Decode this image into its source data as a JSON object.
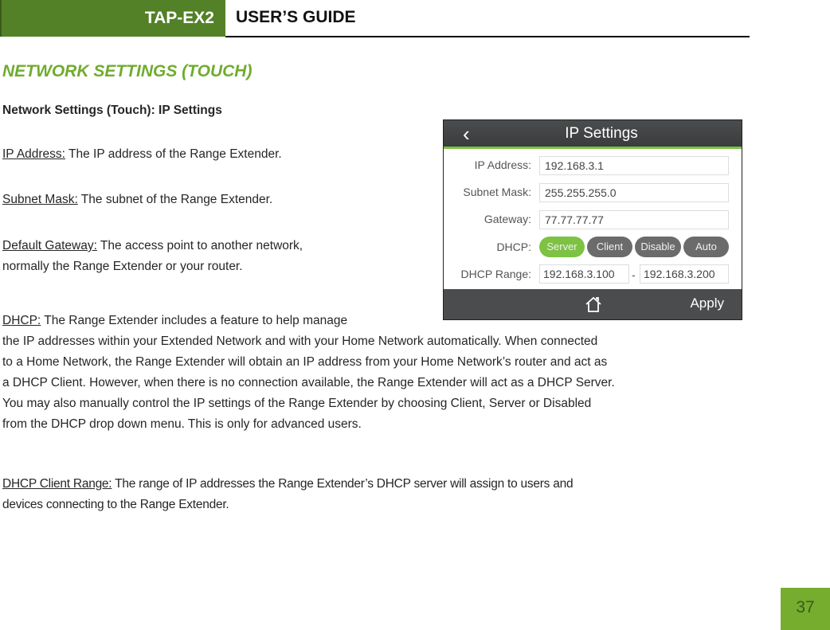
{
  "header": {
    "product": "TAP-EX2",
    "guide": "USER’S GUIDE"
  },
  "section_title": "NETWORK SETTINGS (TOUCH)",
  "subheading": "Network Settings (Touch): IP Settings",
  "paragraphs": {
    "ip_address": {
      "term": "IP Address:",
      "text": " The IP address of the Range Extender."
    },
    "subnet_mask": {
      "term": "Subnet Mask:",
      "text": " The subnet of the Range Extender."
    },
    "default_gateway": {
      "term": "Default Gateway:",
      "line1": " The access point to another network,",
      "line2": "normally the Range Extender or your router."
    },
    "dhcp": {
      "term": "DHCP:",
      "line1": " The Range Extender includes a feature to help manage",
      "line2": "the IP addresses within your Extended Network and with your Home Network automatically. When connected",
      "line3": "to a Home Network, the Range Extender will obtain an IP address from your Home Network’s router and act as",
      "line4": "a DHCP Client. However, when there is no connection available, the Range Extender will act as a DHCP Server.",
      "line5": "You may also manually control the IP settings of the Range Extender by choosing Client, Server or Disabled",
      "line6": "from the DHCP drop down menu. This is only for advanced users."
    },
    "dhcp_client_range": {
      "term": "DHCP Client Range:",
      "line1": " The range of IP addresses the Range Extender’s DHCP server will assign to users and",
      "line2": "devices connecting to the Range Extender."
    }
  },
  "screen": {
    "title": "IP Settings",
    "back_icon": "chevron-left-icon",
    "fields": {
      "ip_address": {
        "label": "IP Address:",
        "value": "192.168.3.1"
      },
      "subnet_mask": {
        "label": "Subnet Mask:",
        "value": "255.255.255.0"
      },
      "gateway": {
        "label": "Gateway:",
        "value": "77.77.77.77"
      }
    },
    "dhcp": {
      "label": "DHCP:",
      "options": [
        "Server",
        "Client",
        "Disable",
        "Auto"
      ],
      "selected": "Server"
    },
    "dhcp_range": {
      "label": "DHCP Range:",
      "start": "192.168.3.100",
      "separator": "-",
      "end": "192.168.3.200"
    },
    "home_icon": "home-icon",
    "apply_label": "Apply",
    "colors": {
      "accent": "#7dc242",
      "bar": "#4a4c4d"
    }
  },
  "page_number": "37",
  "colors": {
    "brand_green": "#538127",
    "title_green": "#6fac2e",
    "page_badge": "#76ad2e"
  }
}
